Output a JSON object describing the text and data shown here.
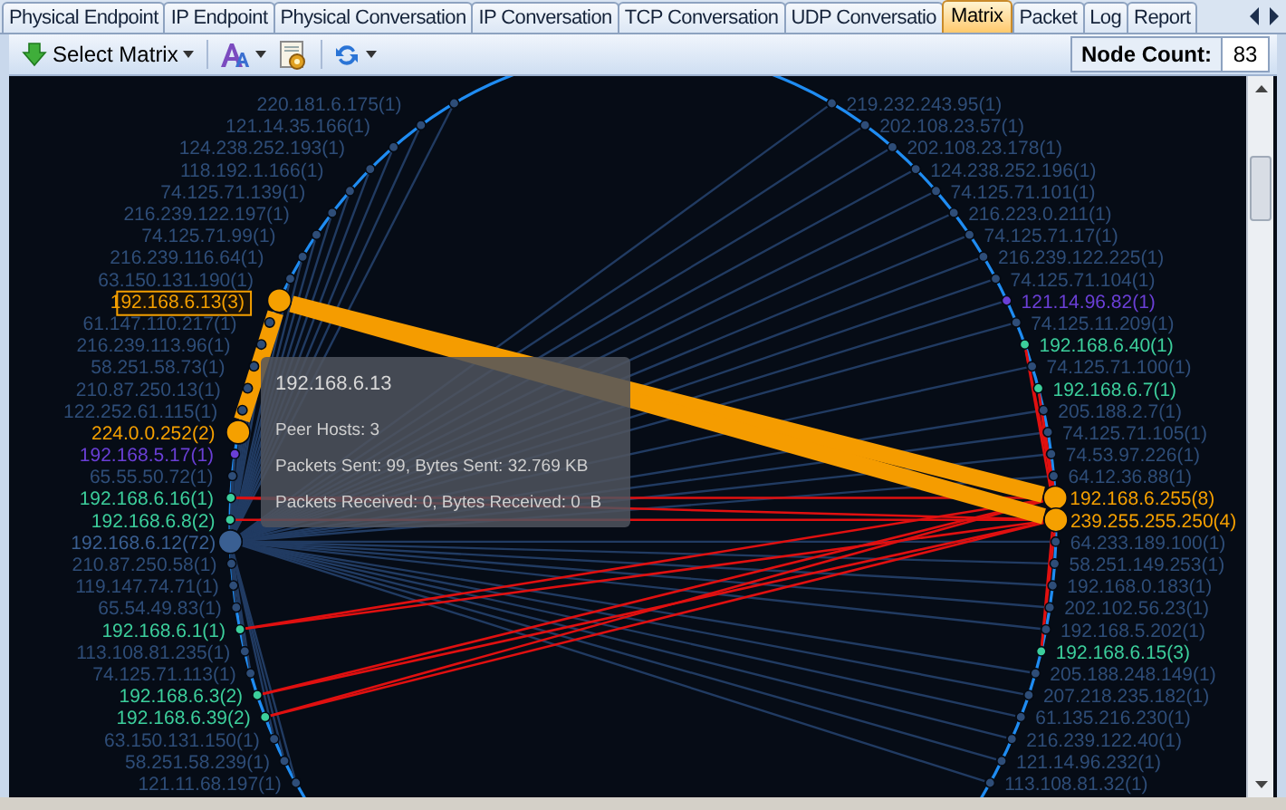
{
  "tabs": [
    {
      "label": "Physical Endpoint",
      "selected": false
    },
    {
      "label": "IP Endpoint",
      "selected": false
    },
    {
      "label": "Physical Conversation",
      "selected": false
    },
    {
      "label": "IP Conversation",
      "selected": false
    },
    {
      "label": "TCP Conversation",
      "selected": false
    },
    {
      "label": "UDP Conversatio",
      "selected": false
    },
    {
      "label": "Matrix",
      "selected": true
    },
    {
      "label": "Packet",
      "selected": false
    },
    {
      "label": "Log",
      "selected": false
    },
    {
      "label": "Report",
      "selected": false
    }
  ],
  "toolbar": {
    "select_matrix": "Select Matrix",
    "node_count_label": "Node Count:",
    "node_count": "83"
  },
  "matrix": {
    "left_nodes": [
      {
        "label": "220.181.6.175(1)",
        "kind": "remote",
        "color": "#2e4d78",
        "selected": false
      },
      {
        "label": "121.14.35.166(1)",
        "kind": "remote",
        "color": "#2e4d78",
        "selected": false
      },
      {
        "label": "124.238.252.193(1)",
        "kind": "remote",
        "color": "#2e4d78",
        "selected": false
      },
      {
        "label": "118.192.1.166(1)",
        "kind": "remote",
        "color": "#2e4d78",
        "selected": false
      },
      {
        "label": "74.125.71.139(1)",
        "kind": "remote",
        "color": "#2e4d78",
        "selected": false
      },
      {
        "label": "216.239.122.197(1)",
        "kind": "remote",
        "color": "#2e4d78",
        "selected": false
      },
      {
        "label": "74.125.71.99(1)",
        "kind": "remote",
        "color": "#2e4d78",
        "selected": false
      },
      {
        "label": "216.239.116.64(1)",
        "kind": "remote",
        "color": "#2e4d78",
        "selected": false
      },
      {
        "label": "63.150.131.190(1)",
        "kind": "remote",
        "color": "#2e4d78",
        "selected": false
      },
      {
        "label": "192.168.6.13(3)",
        "kind": "local",
        "color": "#f5a000",
        "selected": true
      },
      {
        "label": "61.147.110.217(1)",
        "kind": "remote",
        "color": "#2e4d78",
        "selected": false
      },
      {
        "label": "216.239.113.96(1)",
        "kind": "remote",
        "color": "#2e4d78",
        "selected": false
      },
      {
        "label": "58.251.58.73(1)",
        "kind": "remote",
        "color": "#2e4d78",
        "selected": false
      },
      {
        "label": "210.87.250.13(1)",
        "kind": "remote",
        "color": "#2e4d78",
        "selected": false
      },
      {
        "label": "122.252.61.115(1)",
        "kind": "remote",
        "color": "#2e4d78",
        "selected": false
      },
      {
        "label": "224.0.0.252(2)",
        "kind": "broadcast",
        "color": "#f5a000",
        "selected": false
      },
      {
        "label": "192.168.5.17(1)",
        "kind": "remote",
        "color": "#6a3fd6",
        "selected": false
      },
      {
        "label": "65.55.50.72(1)",
        "kind": "remote",
        "color": "#2e4d78",
        "selected": false
      },
      {
        "label": "192.168.6.16(1)",
        "kind": "local",
        "color": "#3ccf9c",
        "selected": false
      },
      {
        "label": "192.168.6.8(2)",
        "kind": "local",
        "color": "#3ccf9c",
        "selected": false
      },
      {
        "label": "192.168.6.12(72)",
        "kind": "hub",
        "color": "#3a5f92",
        "selected": false
      },
      {
        "label": "210.87.250.58(1)",
        "kind": "remote",
        "color": "#2e4d78",
        "selected": false
      },
      {
        "label": "119.147.74.71(1)",
        "kind": "remote",
        "color": "#2e4d78",
        "selected": false
      },
      {
        "label": "65.54.49.83(1)",
        "kind": "remote",
        "color": "#2e4d78",
        "selected": false
      },
      {
        "label": "192.168.6.1(1)",
        "kind": "local",
        "color": "#3ccf9c",
        "selected": false
      },
      {
        "label": "113.108.81.235(1)",
        "kind": "remote",
        "color": "#2e4d78",
        "selected": false
      },
      {
        "label": "74.125.71.113(1)",
        "kind": "remote",
        "color": "#2e4d78",
        "selected": false
      },
      {
        "label": "192.168.6.3(2)",
        "kind": "local",
        "color": "#3ccf9c",
        "selected": false
      },
      {
        "label": "192.168.6.39(2)",
        "kind": "local",
        "color": "#3ccf9c",
        "selected": false
      },
      {
        "label": "63.150.131.150(1)",
        "kind": "remote",
        "color": "#2e4d78",
        "selected": false
      },
      {
        "label": "58.251.58.239(1)",
        "kind": "remote",
        "color": "#2e4d78",
        "selected": false
      },
      {
        "label": "121.11.68.197(1)",
        "kind": "remote",
        "color": "#2e4d78",
        "selected": false
      }
    ],
    "right_nodes": [
      {
        "label": "219.232.243.95(1)",
        "kind": "remote",
        "color": "#2e4d78",
        "selected": false
      },
      {
        "label": "202.108.23.57(1)",
        "kind": "remote",
        "color": "#2e4d78",
        "selected": false
      },
      {
        "label": "202.108.23.178(1)",
        "kind": "remote",
        "color": "#2e4d78",
        "selected": false
      },
      {
        "label": "124.238.252.196(1)",
        "kind": "remote",
        "color": "#2e4d78",
        "selected": false
      },
      {
        "label": "74.125.71.101(1)",
        "kind": "remote",
        "color": "#2e4d78",
        "selected": false
      },
      {
        "label": "216.223.0.211(1)",
        "kind": "remote",
        "color": "#2e4d78",
        "selected": false
      },
      {
        "label": "74.125.71.17(1)",
        "kind": "remote",
        "color": "#2e4d78",
        "selected": false
      },
      {
        "label": "216.239.122.225(1)",
        "kind": "remote",
        "color": "#2e4d78",
        "selected": false
      },
      {
        "label": "74.125.71.104(1)",
        "kind": "remote",
        "color": "#2e4d78",
        "selected": false
      },
      {
        "label": "121.14.96.82(1)",
        "kind": "remote",
        "color": "#6a3fd6",
        "selected": false
      },
      {
        "label": "74.125.11.209(1)",
        "kind": "remote",
        "color": "#2e4d78",
        "selected": false
      },
      {
        "label": "192.168.6.40(1)",
        "kind": "local",
        "color": "#3ccf9c",
        "selected": false
      },
      {
        "label": "74.125.71.100(1)",
        "kind": "remote",
        "color": "#2e4d78",
        "selected": false
      },
      {
        "label": "192.168.6.7(1)",
        "kind": "local",
        "color": "#3ccf9c",
        "selected": false
      },
      {
        "label": "205.188.2.7(1)",
        "kind": "remote",
        "color": "#2e4d78",
        "selected": false
      },
      {
        "label": "74.125.71.105(1)",
        "kind": "remote",
        "color": "#2e4d78",
        "selected": false
      },
      {
        "label": "74.53.97.226(1)",
        "kind": "remote",
        "color": "#2e4d78",
        "selected": false
      },
      {
        "label": "64.12.36.88(1)",
        "kind": "remote",
        "color": "#2e4d78",
        "selected": false
      },
      {
        "label": "192.168.6.255(8)",
        "kind": "broadcast",
        "color": "#f5a000",
        "selected": false
      },
      {
        "label": "239.255.255.250(4)",
        "kind": "broadcast",
        "color": "#f5a000",
        "selected": false
      },
      {
        "label": "64.233.189.100(1)",
        "kind": "remote",
        "color": "#2e4d78",
        "selected": false
      },
      {
        "label": "58.251.149.253(1)",
        "kind": "remote",
        "color": "#2e4d78",
        "selected": false
      },
      {
        "label": "192.168.0.183(1)",
        "kind": "remote",
        "color": "#2e4d78",
        "selected": false
      },
      {
        "label": "202.102.56.23(1)",
        "kind": "remote",
        "color": "#2e4d78",
        "selected": false
      },
      {
        "label": "192.168.5.202(1)",
        "kind": "remote",
        "color": "#2e4d78",
        "selected": false
      },
      {
        "label": "192.168.6.15(3)",
        "kind": "local",
        "color": "#3ccf9c",
        "selected": false
      },
      {
        "label": "205.188.248.149(1)",
        "kind": "remote",
        "color": "#2e4d78",
        "selected": false
      },
      {
        "label": "207.218.235.182(1)",
        "kind": "remote",
        "color": "#2e4d78",
        "selected": false
      },
      {
        "label": "61.135.216.230(1)",
        "kind": "remote",
        "color": "#2e4d78",
        "selected": false
      },
      {
        "label": "216.239.122.40(1)",
        "kind": "remote",
        "color": "#2e4d78",
        "selected": false
      },
      {
        "label": "121.14.96.232(1)",
        "kind": "remote",
        "color": "#2e4d78",
        "selected": false
      },
      {
        "label": "113.108.81.32(1)",
        "kind": "remote",
        "color": "#2e4d78",
        "selected": false
      }
    ]
  },
  "tooltip": {
    "title": "192.168.6.13",
    "lines": [
      "Peer Hosts: 3",
      "Packets Sent: 99, Bytes Sent: 32.769 KB",
      "Packets Received: 0, Bytes Received: 0  B"
    ]
  }
}
